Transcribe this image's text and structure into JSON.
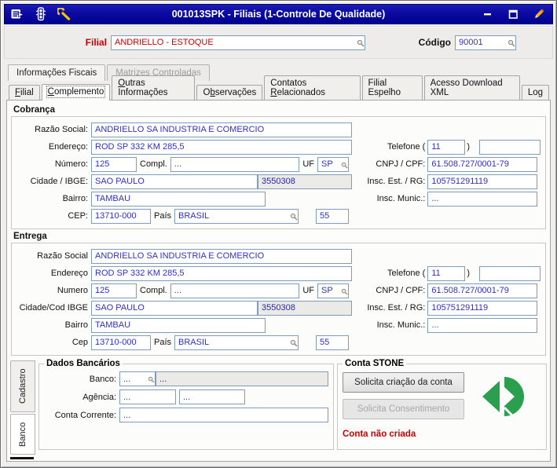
{
  "colors": {
    "titlebar": "#0b0ba2",
    "value_text": "#3030c4",
    "alert_red": "#cc0000",
    "stone_green": "#2aa04e",
    "input_border": "#7f9db9"
  },
  "icons": {
    "titlebar_left": [
      "form-list-icon",
      "traffic-light-icon",
      "wrench-icon"
    ],
    "titlebar_right": [
      "minimize-icon",
      "maximize-icon",
      "edit-pencil-icon"
    ],
    "lookup": "magnifier-icon"
  },
  "window": {
    "title": "001013SPK - Filiais (1-Controle De Qualidade)"
  },
  "header": {
    "filial_label": "Filial",
    "filial_value": "ANDRIELLO - ESTOQUE",
    "codigo_label": "Código",
    "codigo_value": "90001"
  },
  "tabs_outer": {
    "items": [
      {
        "label": "Informações Fiscais",
        "state": "active"
      },
      {
        "label": "Matrizes Controladas",
        "state": "disabled"
      }
    ]
  },
  "tabs_inner": {
    "items": [
      {
        "pre": "",
        "key": "F",
        "rest": "ilial"
      },
      {
        "pre": "",
        "key": "C",
        "rest": "omplemento"
      },
      {
        "pre": "",
        "key": "O",
        "rest": "utras Informações"
      },
      {
        "pre": "O",
        "key": "b",
        "rest": "servações"
      },
      {
        "pre": "Contatos ",
        "key": "R",
        "rest": "elacionados"
      },
      {
        "pre": "Filial Espelho",
        "key": "",
        "rest": ""
      },
      {
        "pre": "Acesso Download XML",
        "key": "",
        "rest": ""
      },
      {
        "pre": "Log",
        "key": "",
        "rest": ""
      }
    ],
    "selected": "Complemento"
  },
  "cobranca": {
    "title": "Cobrança",
    "razao_social_label": "Razão Social:",
    "razao_social": "ANDRIELLO SA INDUSTRIA E COMERCIO",
    "endereco_label": "Endereço:",
    "endereco": "ROD SP 332 KM 285,5",
    "numero_label": "Número:",
    "numero": "125",
    "compl_label": "Compl.",
    "compl": "...",
    "uf_label": "UF",
    "uf": "SP",
    "cidade_label": "Cidade / IBGE:",
    "cidade": "SAO PAULO",
    "ibge": "3550308",
    "bairro_label": "Bairro:",
    "bairro": "TAMBAU",
    "cep_label": "CEP:",
    "cep": "13710-000",
    "pais_label": "País",
    "pais": "BRASIL",
    "ddi": "55",
    "telefone_label": "Telefone (",
    "telefone_close": ")",
    "ddd": "11",
    "telefone_numero": "",
    "cnpj_label": "CNPJ / CPF:",
    "cnpj": "61.508.727/0001-79",
    "insc_est_label": "Insc. Est. / RG:",
    "insc_est": "105751291119",
    "insc_mun_label": "Insc. Munic.:",
    "insc_mun": "..."
  },
  "entrega": {
    "title": "Entrega",
    "razao_social_label": "Razão Social",
    "razao_social": "ANDRIELLO SA INDUSTRIA E COMERCIO",
    "endereco_label": "Endereço",
    "endereco": "ROD SP 332 KM 285,5",
    "numero_label": "Numero",
    "numero": "125",
    "compl_label": "Compl.",
    "compl": "...",
    "uf_label": "UF",
    "uf": "SP",
    "cidade_label": "Cidade/Cod IBGE",
    "cidade": "SAO PAULO",
    "ibge": "3550308",
    "bairro_label": "Bairro",
    "bairro": "TAMBAU",
    "cep_label": "Cep",
    "cep": "13710-000",
    "pais_label": "País",
    "pais": "BRASIL",
    "ddi": "55",
    "telefone_label": "Telefone (",
    "telefone_close": ")",
    "ddd": "11",
    "telefone_numero": "",
    "cnpj_label": "CNPJ / CPF:",
    "cnpj": "61.508.727/0001-79",
    "insc_est_label": "Insc. Est. / RG:",
    "insc_est": "105751291119",
    "insc_mun_label": "Insc. Munic.:",
    "insc_mun": "..."
  },
  "bottom": {
    "side_tabs": {
      "cadastro": "Cadastro",
      "banco": "Banco"
    },
    "dados_bancarios": {
      "title": "Dados Bancários",
      "banco_label": "Banco:",
      "banco_code": "...",
      "banco_name": "...",
      "agencia_label": "Agência:",
      "agencia_code": "...",
      "agencia_extra": "...",
      "conta_label": "Conta Corrente:",
      "conta": "..."
    },
    "conta_stone": {
      "title": "Conta STONE",
      "create_button": "Solicita criação da conta",
      "consent_button": "Solicita Consentimento",
      "status": "Conta não criada"
    }
  }
}
